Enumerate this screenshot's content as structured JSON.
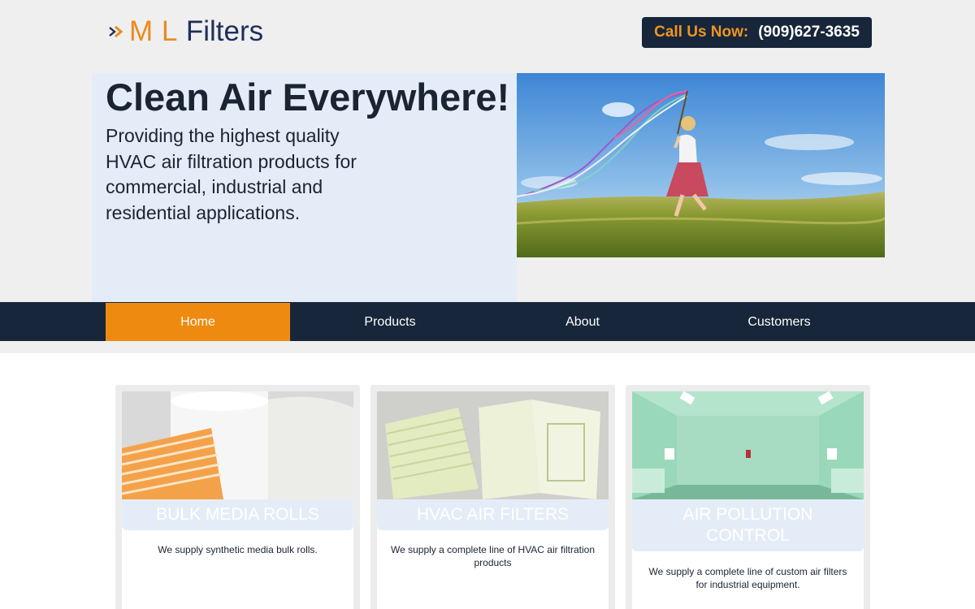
{
  "header": {
    "logo_ml": "M L",
    "logo_filters": "Filters",
    "call_label": "Call Us Now:",
    "phone": "(909)627-3635"
  },
  "hero": {
    "title": "Clean Air Everywhere!",
    "subtitle": "Providing the highest quality HVAC air filtration products for commercial, industrial and residential applications."
  },
  "nav": {
    "items": [
      {
        "label": "Home",
        "active": true
      },
      {
        "label": "Products",
        "active": false
      },
      {
        "label": "About",
        "active": false
      },
      {
        "label": "Customers",
        "active": false
      }
    ]
  },
  "cards": [
    {
      "title": "BULK MEDIA ROLLS",
      "description": "We supply synthetic media bulk rolls."
    },
    {
      "title": "HVAC AIR FILTERS",
      "description": "We supply a complete line of HVAC air filtration products"
    },
    {
      "title": "AIR POLLUTION CONTROL",
      "description": "We supply a complete line of custom air filters for industrial equipment."
    }
  ],
  "colors": {
    "accent_orange": "#ee8a10",
    "navy": "#17263a",
    "logo_blue": "#1f2f5c",
    "panel_blue": "#e4edf7"
  },
  "icons": {
    "logo_mark": "double-chevron-right-icon"
  }
}
